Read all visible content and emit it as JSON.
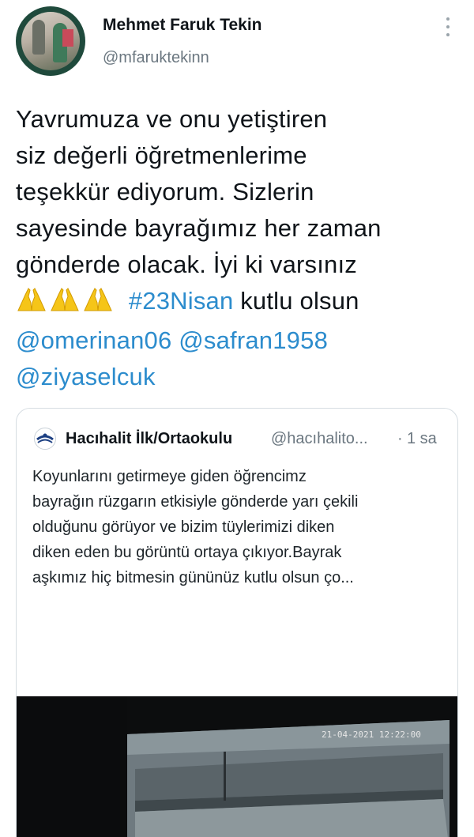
{
  "author": {
    "name": "Mehmet Faruk Tekin",
    "handle": "@mfaruktekinn"
  },
  "tweet": {
    "lines": [
      "Yavrumuza ve onu yetiştiren",
      "siz değerli öğretmenlerime",
      "teşekkür ediyorum. Sizlerin",
      "sayesinde bayrağımız her zaman",
      "gönderde olacak. İyi ki varsınız"
    ],
    "emoji": "🙏🙏🙏",
    "hashtag": "#23Nisan",
    "after_hashtag": " kutlu olsun",
    "mention_1": "@omerinan06",
    "mention_2": "@safran1958",
    "mention_3": "@ziyaselcuk"
  },
  "quote": {
    "name": "Hacıhalit İlk/Ortaokulu",
    "handle": "@hacıhalito...",
    "dot": "·",
    "time": "1 sa",
    "lines": [
      "Koyunlarını getirmeye giden öğrencimz",
      "bayrağın rüzgarın etkisiyle gönderde yarı çekili",
      "olduğunu görüyor ve bizim tüylerimizi diken",
      "diken eden bu görüntü ortaya çıkıyor.Bayrak",
      "aşkımız hiç bitmesin gününüz kutlu olsun ço..."
    ],
    "media_timestamp": "21-04-2021 12:22:00"
  },
  "colors": {
    "link": "#2c8ccd",
    "text": "#0f1419",
    "secondary": "#6b7780",
    "border": "#d6dde2"
  }
}
